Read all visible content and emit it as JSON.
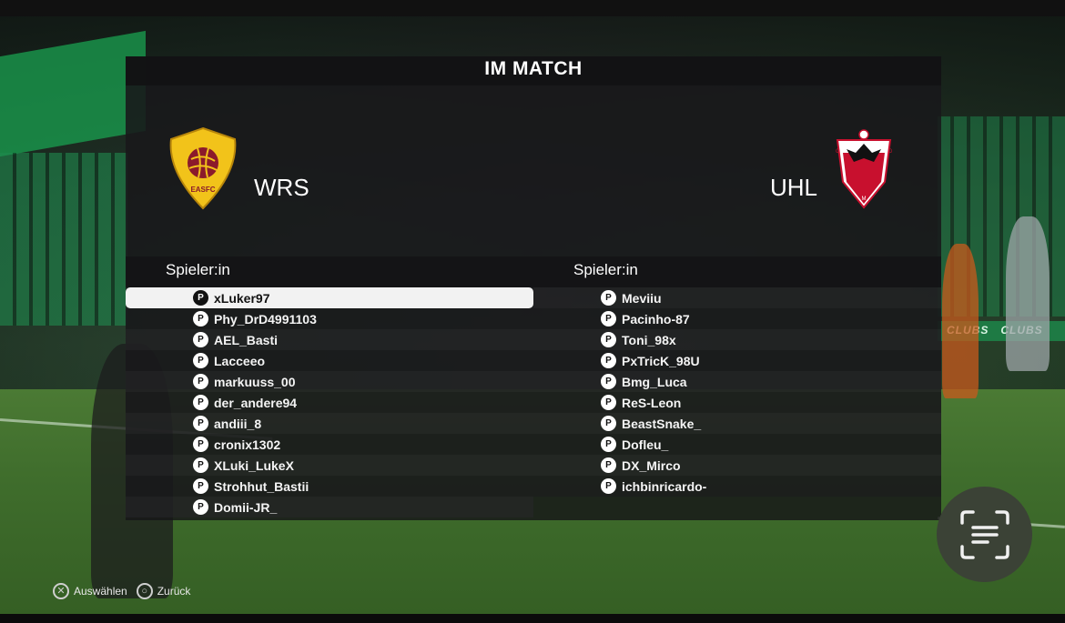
{
  "panel": {
    "title": "IM MATCH"
  },
  "home": {
    "name": "WRS",
    "crest_color": "#f2c31a",
    "column_header": "Spieler:in",
    "players": [
      "xLuker97",
      "Phy_DrD4991103",
      "AEL_Basti",
      "Lacceeo",
      "markuuss_00",
      "der_andere94",
      "andiii_8",
      "cronix1302",
      "XLuki_LukeX",
      "Strohhut_Bastii",
      "Domii-JR_"
    ],
    "selected_index": 0
  },
  "away": {
    "name": "UHL",
    "crest_color": "#c8102e",
    "column_header": "Spieler:in",
    "players": [
      "Meviiu",
      "Pacinho-87",
      "Toni_98x",
      "PxTricK_98U",
      "Bmg_Luca",
      "ReS-Leon",
      "BeastSnake_",
      "Dofleu_",
      "DX_Mirco",
      "ichbinricardo-"
    ]
  },
  "player_icon": "playstation-icon",
  "hints": {
    "select": "Auswählen",
    "back": "Zurück"
  },
  "scan_button_icon": "text-scan-icon",
  "colors": {
    "selected_row": "#f2f2f2",
    "panel_bg": "#161618",
    "scan_button": "#3b4236"
  }
}
